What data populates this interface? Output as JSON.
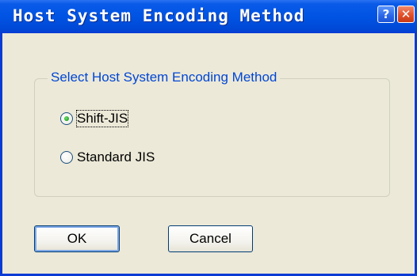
{
  "dialog": {
    "title": "Host System Encoding Method",
    "help_button": "?",
    "close_button": "✕"
  },
  "group": {
    "label": "Select Host System Encoding Method",
    "options": [
      {
        "label": "Shift-JIS",
        "selected": true
      },
      {
        "label": "Standard JIS",
        "selected": false
      }
    ]
  },
  "buttons": {
    "ok": "OK",
    "cancel": "Cancel"
  },
  "colors": {
    "titlebar": "#0054e3",
    "group_label": "#0046d5",
    "dialog_bg": "#ece9d8",
    "close_button": "#e2502a"
  }
}
